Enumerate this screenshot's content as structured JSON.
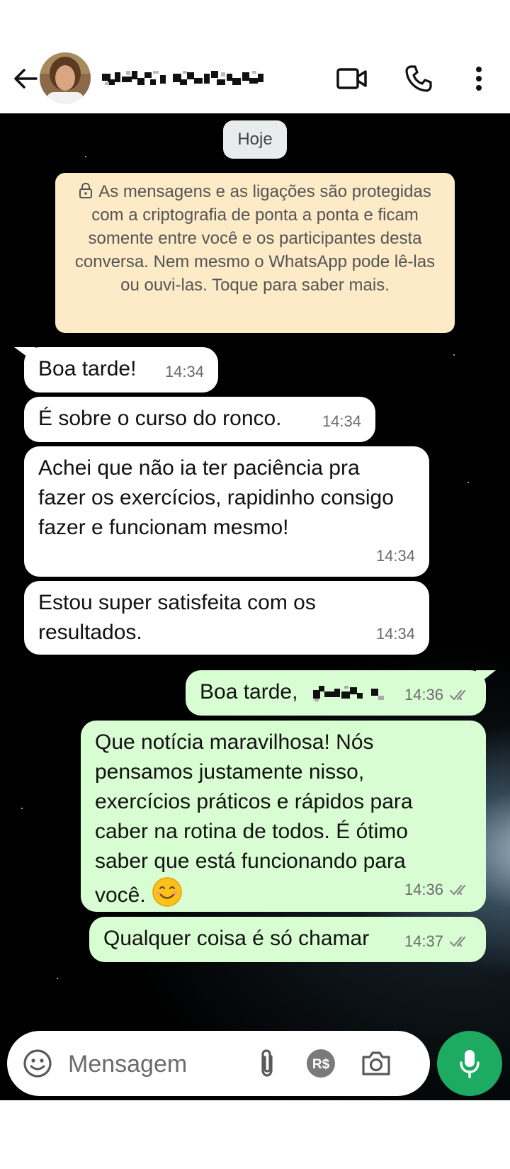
{
  "header": {
    "contact_name": "",
    "icons": [
      "back-arrow-icon",
      "video-call-icon",
      "voice-call-icon",
      "more-options-icon"
    ]
  },
  "chat": {
    "date_chip": "Hoje",
    "encryption_notice": "As mensagens e as ligações são protegidas com a criptografia de ponta a ponta e ficam somente entre você e os participantes desta conversa. Nem mesmo o WhatsApp pode lê-las ou ouvi-las. Toque para saber mais.",
    "messages": [
      {
        "direction": "in",
        "text": "Boa tarde!",
        "time": "14:34"
      },
      {
        "direction": "in",
        "text": "É sobre o curso do ronco.",
        "time": "14:34"
      },
      {
        "direction": "in",
        "text": "Achei que não ia ter paciência pra fazer os exercícios, rapidinho consigo fazer e funcionam mesmo!",
        "time": "14:34"
      },
      {
        "direction": "in",
        "text": "Estou super satisfeita com os resultados.",
        "time": "14:34"
      },
      {
        "direction": "out",
        "text": "Boa tarde,",
        "time": "14:36",
        "status": "read"
      },
      {
        "direction": "out",
        "text": "Que notícia maravilhosa! Nós pensamos justamente nisso, exercícios práticos e rápidos para caber na rotina de todos. É ótimo saber que está funcionando para você.",
        "emoji": "smiling-face",
        "time": "14:36",
        "status": "read"
      },
      {
        "direction": "out",
        "text": "Qualquer coisa é só chamar",
        "time": "14:37",
        "status": "read"
      }
    ]
  },
  "composer": {
    "placeholder": "Mensagem",
    "icons": [
      "emoji-icon",
      "attach-icon",
      "payment-icon",
      "camera-icon",
      "mic-icon"
    ]
  },
  "colors": {
    "incoming_bubble": "#ffffff",
    "outgoing_bubble": "#d9fdd3",
    "notice_bg": "#fdeac6",
    "mic_button": "#1daa61",
    "read_ticks": "#8a8a8a"
  }
}
